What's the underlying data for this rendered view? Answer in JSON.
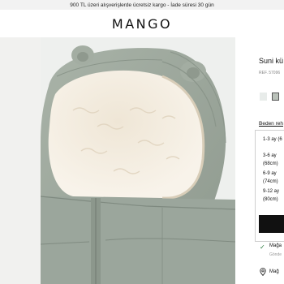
{
  "promo": {
    "text": "900 TL üzeri alışverişlerde ücretsiz kargo - İade süresi 30 gün"
  },
  "header": {
    "logo": "MANGO"
  },
  "product": {
    "name": "Suni kü",
    "ref": "REF. 57096",
    "swatches": [
      {
        "color": "#e8ecea",
        "selected": false
      },
      {
        "color": "#b9c1b9",
        "selected": true
      }
    ],
    "size_guide": "Beden reh",
    "sizes": [
      "1-3 ay (6",
      "3-6 ay",
      "(68cm)",
      "6-9 ay",
      "(74cm)",
      "9-12 ay",
      "(80cm)"
    ],
    "stock": {
      "text": "Mağa",
      "subtext": "Gönde"
    },
    "store": {
      "text": "Mağ"
    }
  },
  "colors": {
    "jacket": "#9aa59b",
    "sherpa": "#f3ece0",
    "button_dark": "#111111"
  }
}
